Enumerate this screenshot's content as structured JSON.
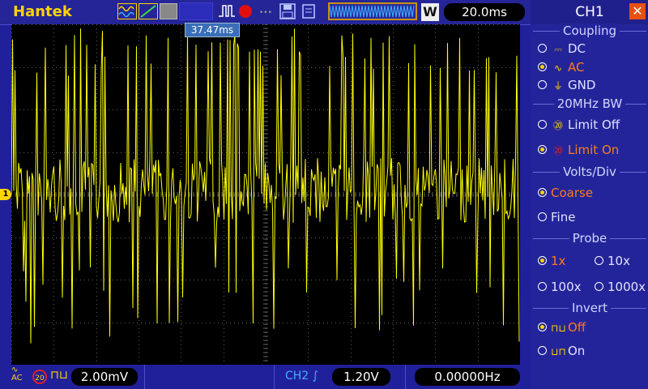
{
  "app": {
    "brand": "Hantek"
  },
  "toolbar": {
    "small_label": "W",
    "timebase": "20.0ms",
    "save_icon": "save-icon",
    "print_icon": "print-icon"
  },
  "scope": {
    "trigger_marker": "37.47ms",
    "ch1_marker": "1",
    "trace_color": "#ffff00"
  },
  "status": {
    "coupling_top": "AC",
    "bw_label": "20",
    "ch1_volts": "2.00mV",
    "trig_source": "CH2",
    "trig_level": "1.20V",
    "frequency": "0.00000Hz"
  },
  "panel": {
    "title": "CH1",
    "close_icon": "close-icon",
    "coupling": {
      "title": "Coupling",
      "options": [
        "DC",
        "AC",
        "GND"
      ],
      "selected": "AC"
    },
    "bw": {
      "title": "20MHz BW",
      "options": [
        "Limit Off",
        "Limit On"
      ],
      "selected": "Limit On"
    },
    "volts": {
      "title": "Volts/Div",
      "options": [
        "Coarse",
        "Fine"
      ],
      "selected": "Coarse"
    },
    "probe": {
      "title": "Probe",
      "options": [
        "1x",
        "10x",
        "100x",
        "1000x"
      ],
      "selected": "1x"
    },
    "invert": {
      "title": "Invert",
      "options": [
        "Off",
        "On"
      ],
      "selected": "Off"
    }
  },
  "colors": {
    "accent": "#ffd400",
    "selected": "#ff7a1a",
    "panel_bg": "#24249a"
  }
}
